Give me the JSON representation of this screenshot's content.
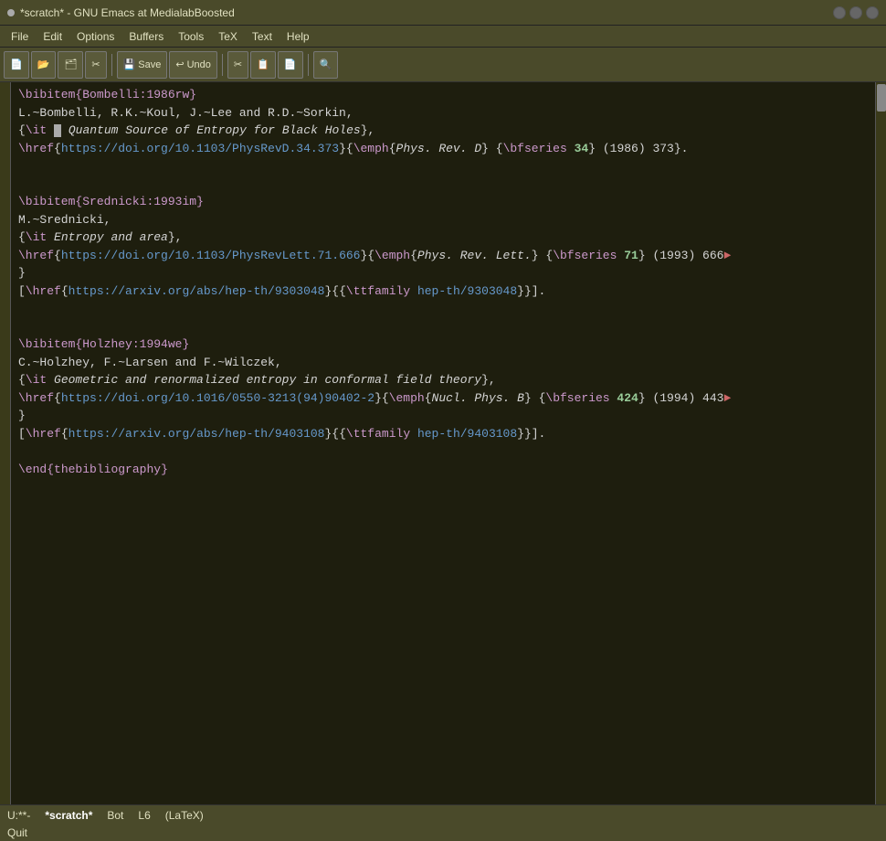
{
  "titlebar": {
    "title": "*scratch* - GNU Emacs at MedialabBoosted",
    "active_dot": "●"
  },
  "menubar": {
    "items": [
      "File",
      "Edit",
      "Options",
      "Buffers",
      "Tools",
      "TeX",
      "Text",
      "Help"
    ]
  },
  "toolbar": {
    "buttons": [
      {
        "label": "",
        "icon": "📄",
        "name": "new-file"
      },
      {
        "label": "",
        "icon": "📂",
        "name": "open-file"
      },
      {
        "label": "",
        "icon": "🗂",
        "name": "open-dir"
      },
      {
        "label": "",
        "icon": "✂",
        "name": "cut"
      },
      {
        "label": "Save",
        "icon": "💾",
        "name": "save"
      },
      {
        "label": "Undo",
        "icon": "↩",
        "name": "undo"
      },
      {
        "label": "",
        "icon": "✂",
        "name": "cut2"
      },
      {
        "label": "",
        "icon": "📋",
        "name": "copy"
      },
      {
        "label": "",
        "icon": "📄",
        "name": "paste"
      },
      {
        "label": "",
        "icon": "🔍",
        "name": "search"
      }
    ]
  },
  "statusbar": {
    "mode_indicator": "U:**-",
    "buffer_name": "*scratch*",
    "position": "Bot",
    "line": "L6",
    "major_mode": "(LaTeX)"
  },
  "echo_area": {
    "text": "Quit"
  },
  "editor": {
    "lines": []
  }
}
